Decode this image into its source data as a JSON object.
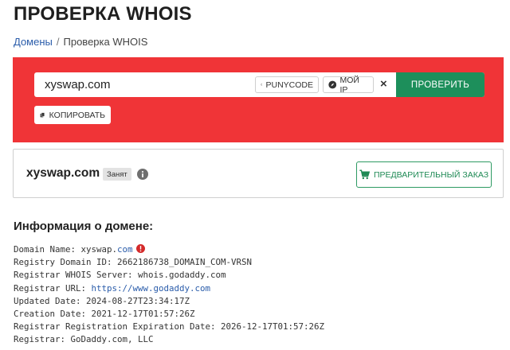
{
  "page": {
    "title": "ПРОВЕРКА WHOIS"
  },
  "breadcrumb": {
    "home": "Домены",
    "separator": "/",
    "current": "Проверка WHOIS"
  },
  "search": {
    "value": "xyswap.com",
    "punycode_label": "PUNYCODE",
    "myip_label": "МОЙ IP",
    "clear_label": "×",
    "submit_label": "ПРОВЕРИТЬ",
    "copy_label": "КОПИРОВАТЬ"
  },
  "result": {
    "domain": "xyswap.com",
    "status": "Занят",
    "preorder_label": "ПРЕДВАРИТЕЛЬНЫЙ ЗАКАЗ"
  },
  "info": {
    "title": "Информация о домене:",
    "lines": [
      {
        "key": "Domain Name:",
        "value": "xyswap.",
        "link": "com",
        "alert": true
      },
      {
        "key": "Registry Domain ID:",
        "value": "2662186738_DOMAIN_COM-VRSN"
      },
      {
        "key": "Registrar WHOIS Server:",
        "value": "whois.godaddy.com"
      },
      {
        "key": "Registrar URL:",
        "value": "",
        "link": "https://www.godaddy.com"
      },
      {
        "key": "Updated Date:",
        "value": "2024-08-27T23:34:17Z"
      },
      {
        "key": "Creation Date:",
        "value": "2021-12-17T01:57:26Z"
      },
      {
        "key": "Registrar Registration Expiration Date:",
        "value": "2026-12-17T01:57:26Z"
      },
      {
        "key": "Registrar:",
        "value": "GoDaddy.com, LLC"
      }
    ]
  },
  "colors": {
    "panel_red": "#f03437",
    "button_green": "#1d8f5b",
    "link_blue": "#2a5caa",
    "alert_red": "#d42a2a"
  }
}
